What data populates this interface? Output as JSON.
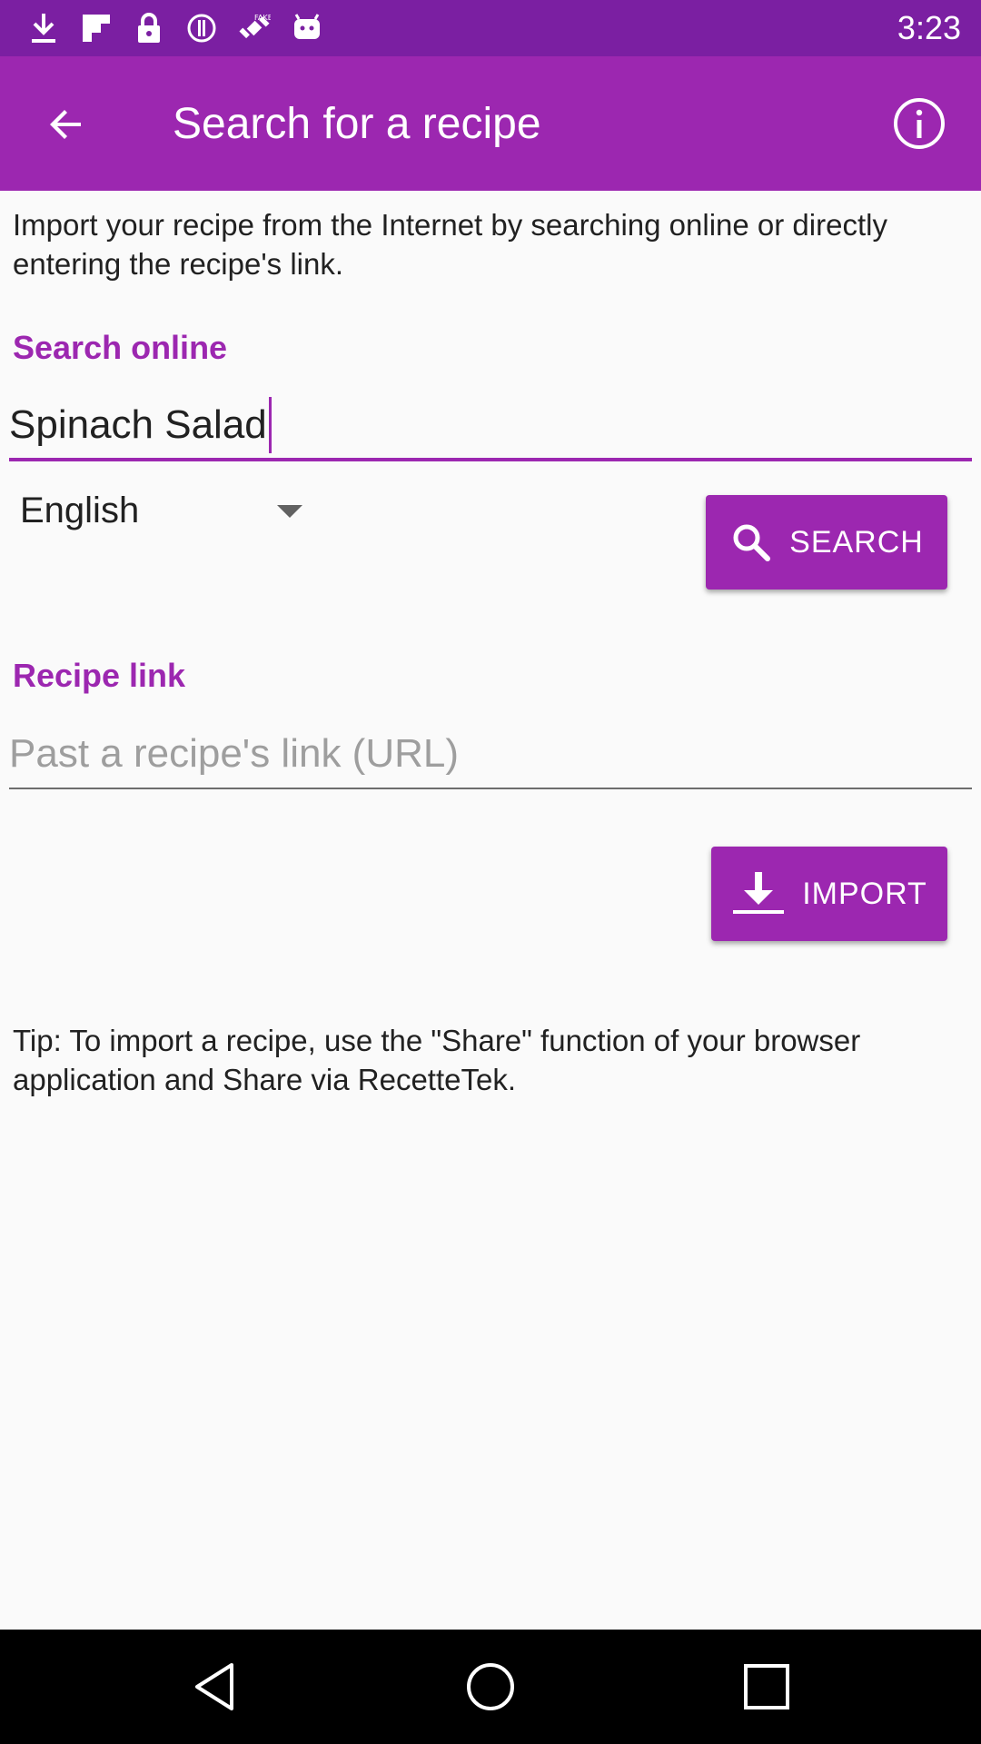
{
  "status_bar": {
    "time": "3:23",
    "icons": [
      "download-icon",
      "flipboard-icon",
      "lock-icon",
      "info-circle-icon",
      "fake-gps-icon",
      "android-icon"
    ]
  },
  "app_bar": {
    "title": "Search for a recipe",
    "background": "#9c27b0"
  },
  "intro_text": "Import your recipe from the Internet by searching online or directly entering the recipe's link.",
  "search_online": {
    "label": "Search online",
    "value": "Spinach Salad",
    "language": "English",
    "button_label": "SEARCH"
  },
  "recipe_link": {
    "label": "Recipe link",
    "placeholder": "Past a recipe's link (URL)",
    "value": "",
    "button_label": "IMPORT"
  },
  "tip_text": "Tip: To import a recipe, use the \"Share\" function of your browser application and Share via RecetteTek.",
  "colors": {
    "accent": "#9c27b0",
    "status_bar": "#7b1fa2"
  }
}
